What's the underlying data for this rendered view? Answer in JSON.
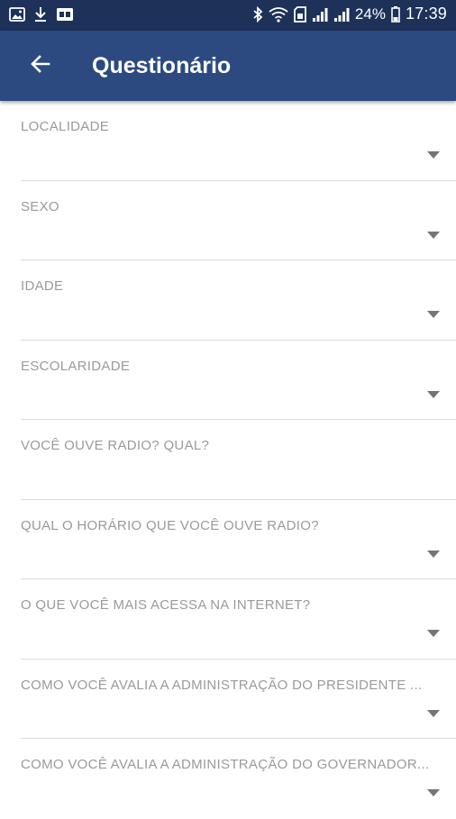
{
  "status_bar": {
    "battery_percent": "24%",
    "time": "17:39",
    "left_icons": [
      "image-icon",
      "download-icon",
      "cast-icon"
    ],
    "right_icons": [
      "bluetooth-icon",
      "wifi-icon",
      "signal-icon",
      "signal-icon",
      "battery-icon"
    ]
  },
  "app_bar": {
    "title": "Questionário",
    "back_icon": "arrow-back-icon"
  },
  "colors": {
    "status_bar": "#1d3159",
    "app_bar": "#2c4a7f",
    "label": "#9a9a9a",
    "divider": "#dcdcdc",
    "arrow": "#757575"
  },
  "form": {
    "fields": [
      {
        "label": "LOCALIDADE",
        "type": "dropdown"
      },
      {
        "label": "SEXO",
        "type": "dropdown"
      },
      {
        "label": "IDADE",
        "type": "dropdown"
      },
      {
        "label": "ESCOLARIDADE",
        "type": "dropdown"
      },
      {
        "label": "VOCÊ OUVE RADIO? QUAL?",
        "type": "text"
      },
      {
        "label": "QUAL O HORÁRIO QUE VOCÊ OUVE RADIO?",
        "type": "dropdown"
      },
      {
        "label": "O QUE VOCÊ MAIS ACESSA NA INTERNET?",
        "type": "dropdown"
      },
      {
        "label": "COMO VOCÊ AVALIA A ADMINISTRAÇÃO DO PRESIDENTE ...",
        "type": "dropdown"
      },
      {
        "label": "COMO VOCÊ AVALIA A ADMINISTRAÇÃO DO GOVERNADOR...",
        "type": "dropdown"
      }
    ]
  }
}
